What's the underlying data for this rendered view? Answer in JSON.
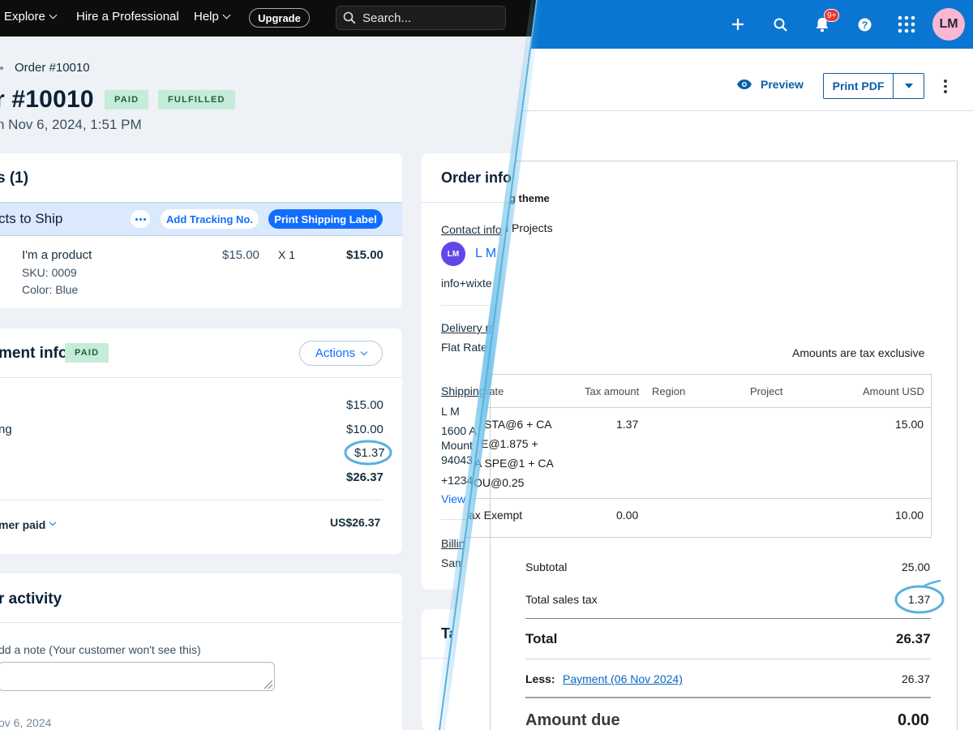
{
  "left": {
    "nav": {
      "explore": "Explore",
      "hire": "Hire a Professional",
      "help": "Help",
      "upgrade": "Upgrade",
      "search_placeholder": "Search..."
    },
    "breadcrumb": "Order #10010",
    "order_title": "r #10010",
    "badges": {
      "paid": "PAID",
      "fulfilled": "FULFILLED"
    },
    "order_date": "n Nov 6, 2024, 1:51 PM",
    "items_card": {
      "title": "s (1)",
      "band_title": "cts to Ship",
      "add_tracking": "Add Tracking No.",
      "print_label": "Print Shipping Label",
      "product": {
        "name": "I'm a product",
        "sku": "SKU: 0009",
        "color": "Color: Blue",
        "price": "$15.00",
        "qty": "X 1",
        "total": "$15.00"
      }
    },
    "payment_card": {
      "title": "ment info",
      "badge": "PAID",
      "actions": "Actions",
      "shipping_label": "ng",
      "subtotal": "$15.00",
      "shipping": "$10.00",
      "tax": "$1.37",
      "total": "$26.37",
      "customer_paid_label": "mer paid",
      "customer_paid": "US$26.37"
    },
    "activity_card": {
      "title": "r activity",
      "note_label": "dd a note (Your customer won't see this)",
      "date": "ov 6, 2024"
    },
    "order_info_card": {
      "title": "Order info",
      "contact_label": "Contact info",
      "avatar": "LM",
      "name": "L M",
      "email": "info+wixte",
      "delivery_label": "Delivery m",
      "delivery_value": "Flat Rate",
      "shipping_label": "Shipping",
      "ship_name": "L M",
      "ship_line1": "1600 A",
      "ship_line2": "Mount",
      "ship_line3": "94043",
      "ship_phone": "+1234",
      "view": "View",
      "billing_label": "Billin",
      "billing_value": "Sam",
      "next_card_title": "Ta"
    }
  },
  "right": {
    "topbar": {
      "notification_count": "9+",
      "avatar": "LM"
    },
    "toolbar": {
      "preview": "Preview",
      "print_pdf": "Print PDF"
    },
    "invoice": {
      "theme_line": "ng theme",
      "project_line": "l Projects",
      "tax_note": "Amounts are tax exclusive",
      "columns": [
        "rate",
        "Tax amount",
        "Region",
        "Project",
        "Amount USD"
      ],
      "rows": [
        {
          "rate": [
            "STA@6 + CA",
            "E@1.875 +",
            "A SPE@1 + CA",
            "OU@0.25"
          ],
          "tax": "1.37",
          "amount": "15.00"
        },
        {
          "rate": [
            "ax Exempt"
          ],
          "tax": "0.00",
          "amount": "10.00"
        }
      ],
      "subtotal_label": "Subtotal",
      "subtotal": "25.00",
      "total_tax_label": "Total sales tax",
      "total_tax": "1.37",
      "total_label": "Total",
      "total": "26.37",
      "less_label": "Less:",
      "payment_link": "Payment (06 Nov 2024)",
      "payment_amount": "26.37",
      "amount_due_label": "Amount due",
      "amount_due": "0.00"
    }
  },
  "colors": {
    "wix_blue": "#116dff",
    "paid_green": "#c5ebd9",
    "xero_blue": "#0a76d1",
    "highlight_circle": "#5bb0dd"
  }
}
